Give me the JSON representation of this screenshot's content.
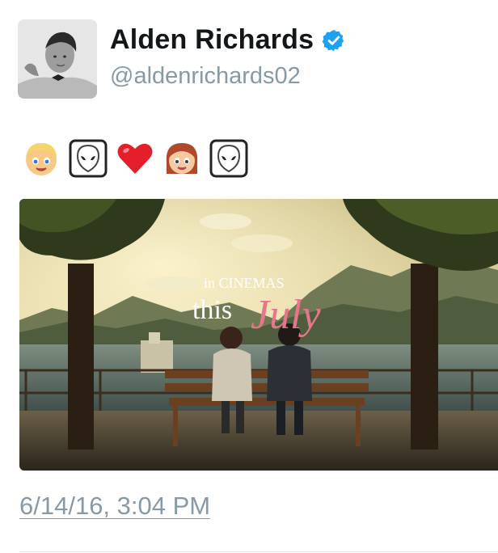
{
  "tweet": {
    "author": {
      "display_name": "Alden Richards",
      "handle": "@aldenrichards02",
      "verified_icon": "verified-badge-icon",
      "verified_color": "#1da1f2"
    },
    "text_emojis": [
      "boy-emoji",
      "alien-emoji",
      "red-heart-emoji",
      "girl-emoji",
      "alien-emoji"
    ],
    "media": {
      "icon": "photo",
      "overlay_line1": "in CINEMAS",
      "overlay_line2_a": "this",
      "overlay_line2_b": "July"
    },
    "timestamp": "6/14/16, 3:04 PM"
  },
  "colors": {
    "name": "#14171a",
    "secondary": "#8899a6",
    "script_pink": "#e8768a"
  }
}
